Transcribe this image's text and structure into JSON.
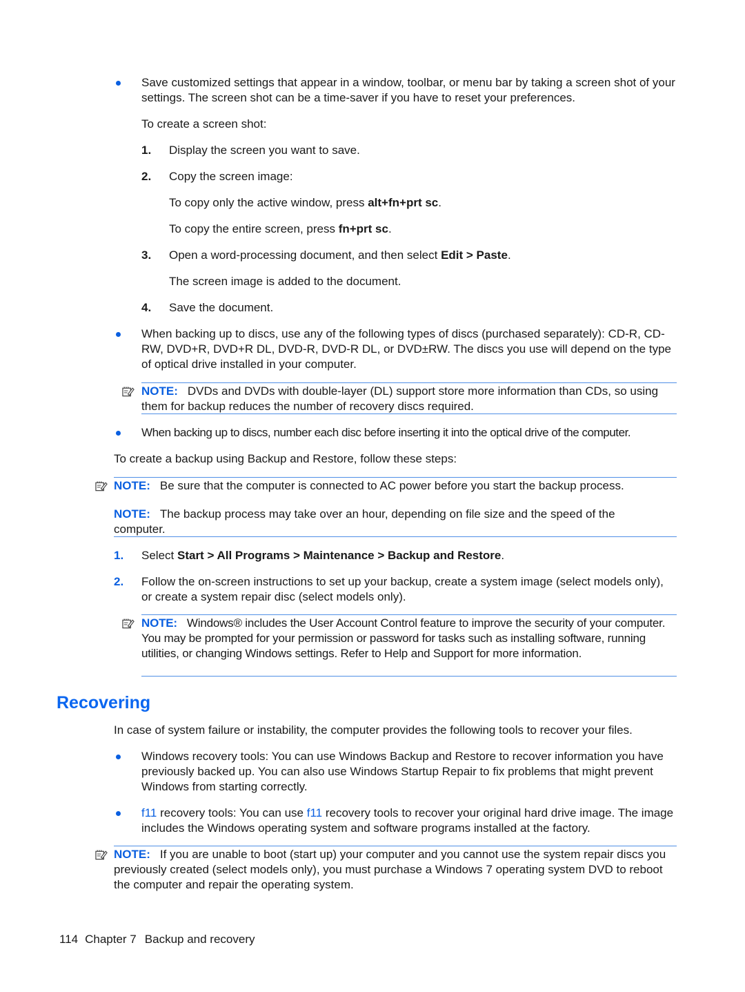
{
  "section1": {
    "bullet1": {
      "text": "Save customized settings that appear in a window, toolbar, or menu bar by taking a screen shot of your settings. The screen shot can be a time-saver if you have to reset your preferences.",
      "intro": "To create a screen shot:",
      "steps": [
        {
          "num": "1.",
          "text": "Display the screen you want to save."
        },
        {
          "num": "2.",
          "text": "Copy the screen image:",
          "sub1_pre": "To copy only the active window, press ",
          "sub1_bold": "alt+fn+prt sc",
          "sub1_post": ".",
          "sub2_pre": "To copy the entire screen, press ",
          "sub2_bold": "fn+prt sc",
          "sub2_post": "."
        },
        {
          "num": "3.",
          "pre": "Open a word-processing document, and then select ",
          "bold": "Edit > Paste",
          "post": ".",
          "sub": "The screen image is added to the document."
        },
        {
          "num": "4.",
          "text": "Save the document."
        }
      ]
    },
    "bullet2": "When backing up to discs, use any of the following types of discs (purchased separately): CD-R, CD-RW, DVD+R, DVD+R DL, DVD-R, DVD-R DL, or DVD±RW. The discs you use will depend on the type of optical drive installed in your computer.",
    "note1": {
      "label": "NOTE:",
      "text": "DVDs and DVDs with double-layer (DL) support store more information than CDs, so using them for backup reduces the number of recovery discs required."
    },
    "bullet3": "When backing up to discs, number each disc before inserting it into the optical drive of the computer.",
    "intro": "To create a backup using Backup and Restore, follow these steps:",
    "note2": {
      "label": "NOTE:",
      "text": "Be sure that the computer is connected to AC power before you start the backup process."
    },
    "note3": {
      "label": "NOTE:",
      "text": "The backup process may take over an hour, depending on file size and the speed of the computer."
    },
    "steps": [
      {
        "num": "1.",
        "pre": "Select ",
        "bold": "Start > All Programs > Maintenance > Backup and Restore",
        "post": "."
      },
      {
        "num": "2.",
        "text": "Follow the on-screen instructions to set up your backup, create a system image (select models only), or create a system repair disc (select models only)."
      }
    ],
    "note4": {
      "label": "NOTE:",
      "text": "Windows® includes the User Account Control feature to improve the security of your computer. You may be prompted for your permission or password for tasks such as installing software, running utilities, or changing Windows settings. Refer to Help and Support for more information."
    }
  },
  "recovering": {
    "heading": "Recovering",
    "intro": "In case of system failure or instability, the computer provides the following tools to recover your files.",
    "bullet1": "Windows recovery tools: You can use Windows Backup and Restore to recover information you have previously backed up. You can also use Windows Startup Repair to fix problems that might prevent Windows from starting correctly.",
    "bullet2": {
      "f11a": "f11",
      "text_a": " recovery tools: You can use ",
      "f11b": "f11",
      "text_b": " recovery tools to recover your original hard drive image. The image includes the Windows operating system and software programs installed at the factory."
    },
    "note": {
      "label": "NOTE:",
      "text": "If you are unable to boot (start up) your computer and you cannot use the system repair discs you previously created (select models only), you must purchase a Windows 7 operating system DVD to reboot the computer and repair the operating system."
    }
  },
  "footer": {
    "page": "114",
    "chapter": "Chapter 7",
    "title": "Backup and recovery"
  }
}
